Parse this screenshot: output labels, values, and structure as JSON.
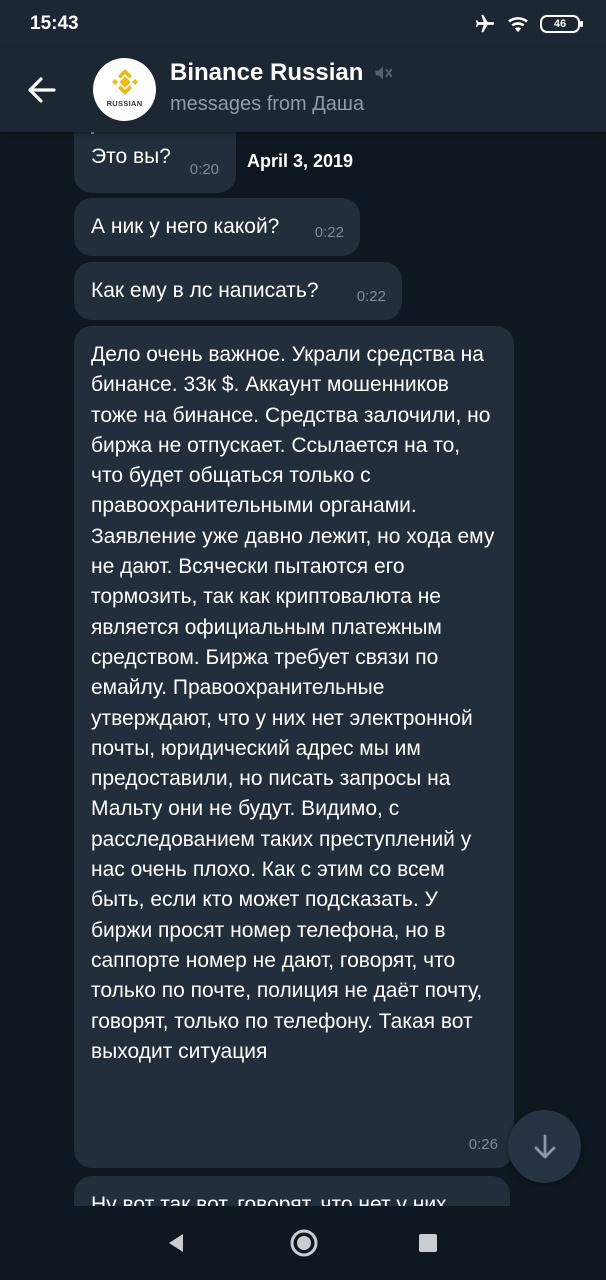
{
  "status_bar": {
    "time": "15:43",
    "battery": "46"
  },
  "header": {
    "title": "Binance Russian",
    "subtitle": "messages from Даша",
    "avatar_text": "RUSSIAN"
  },
  "date_chip": "April 3, 2019",
  "messages": [
    {
      "text": "Это вы?",
      "time": "0:20"
    },
    {
      "text": "А ник у него какой?",
      "time": "0:22"
    },
    {
      "text": "Как ему в лс написать?",
      "time": "0:22"
    },
    {
      "text": "Дело очень важное. Украли средства на бинансе. 33к $. Аккаунт мошенников тоже на бинансе. Средства залочили, но биржа не отпускает. Ссылается на то, что будет общаться только с правоохранительными органами. Заявление уже давно лежит, но хода ему не дают. Всячески пытаются его тормозить, так как криптовалюта не является официальным платежным средством. Биржа требует связи по емайлу. Правоохранительные утверждают, что у них нет электронной почты, юридический адрес мы им предоставили, но писать запросы на Мальту они не будут. Видимо, с расследованием таких преступлений у нас очень плохо. Как с этим со всем быть, если кто может подсказать. У биржи просят номер телефона, но в саппорте номер не дают, говорят, что только по почте, полиция не даёт почту, говорят, только по телефону. Такая вот выходит ситуация",
      "time": "0:26"
    },
    {
      "text": "Ну вот так вот, говорят, что нет у них",
      "time": ""
    }
  ],
  "icons": {
    "airplane": "airplane-icon",
    "wifi": "wifi-icon",
    "back": "arrow-left-icon",
    "mute": "muted-speaker-icon",
    "scroll_down": "arrow-down-icon"
  },
  "colors": {
    "background": "#0f1821",
    "header": "#1c2733",
    "bubble": "#222e3b",
    "timestamp": "#7d8a97",
    "logo": "#f0b90b"
  }
}
